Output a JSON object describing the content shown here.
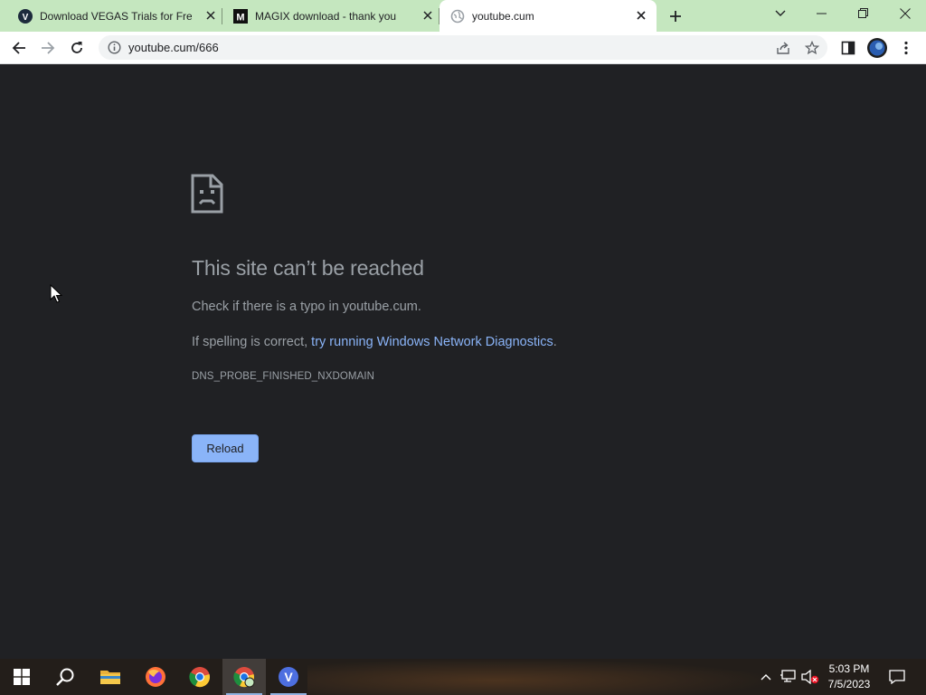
{
  "browser": {
    "tabs": [
      {
        "title": "Download VEGAS Trials for Free |",
        "favicon": "vegas-v-icon",
        "active": false
      },
      {
        "title": "MAGIX download - thank you",
        "favicon": "magix-m-icon",
        "active": false
      },
      {
        "title": "youtube.cum",
        "favicon": "globe-icon",
        "active": true
      }
    ],
    "address": "youtube.cum/666",
    "accent_color": "#c5e7bf"
  },
  "error_page": {
    "title": "This site can’t be reached",
    "line1": "Check if there is a typo in youtube.cum.",
    "line2_prefix": "If spelling is correct, ",
    "line2_link": "try running Windows Network Diagnostics",
    "line2_suffix": ".",
    "error_code": "DNS_PROBE_FINISHED_NXDOMAIN",
    "reload_label": "Reload"
  },
  "taskbar": {
    "items": [
      "start-icon",
      "search-icon",
      "file-explorer-icon",
      "firefox-icon",
      "chrome-icon",
      "chrome-active-icon",
      "vegas-icon"
    ],
    "time": "5:03 PM",
    "date": "7/5/2023"
  }
}
